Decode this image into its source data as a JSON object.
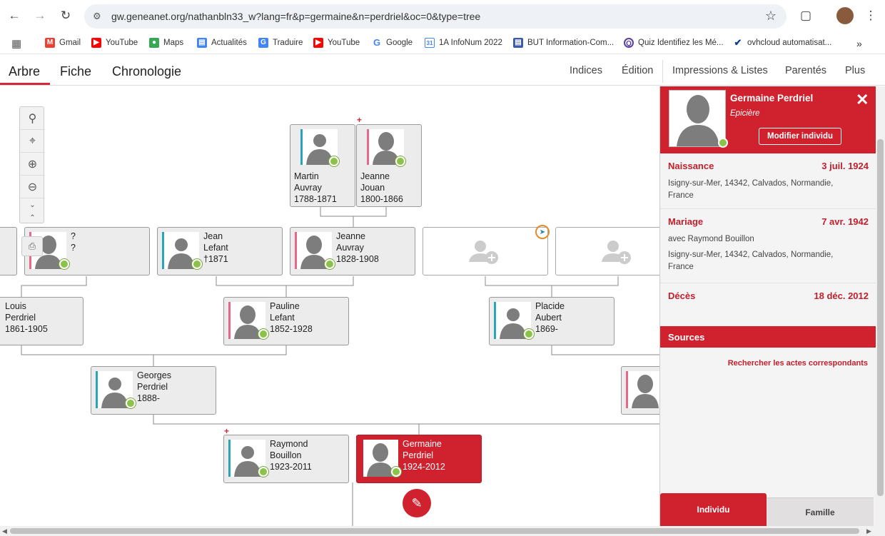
{
  "browser": {
    "url": "gw.geneanet.org/nathanbln33_w?lang=fr&p=germaine&n=perdriel&oc=0&type=tree",
    "bookmarks": [
      {
        "label": "Gmail",
        "color": "#ea4335"
      },
      {
        "label": "YouTube",
        "color": "#ff0000"
      },
      {
        "label": "Maps",
        "color": "#34a853"
      },
      {
        "label": "Actualités",
        "color": "#4285f4"
      },
      {
        "label": "Traduire",
        "color": "#4285f4"
      },
      {
        "label": "YouTube",
        "color": "#ff0000"
      },
      {
        "label": "Google",
        "color": "#4285f4"
      },
      {
        "label": "1A InfoNum 2022",
        "color": "#4285f4"
      },
      {
        "label": "BUT Information-Com...",
        "color": "#3b5bab"
      },
      {
        "label": "Quiz Identifiez les Mé...",
        "color": "#5b3ea8"
      },
      {
        "label": "ovhcloud automatisat...",
        "color": "#123f8c"
      }
    ],
    "more": "»"
  },
  "nav": {
    "tabs": [
      "Arbre",
      "Fiche",
      "Chronologie"
    ],
    "right": [
      "Indices",
      "Édition",
      "Impressions & Listes",
      "Parentés",
      "Plus"
    ]
  },
  "tree": {
    "people": {
      "martin": {
        "first": "Martin",
        "last": "Auvray",
        "dates": "1788-1871"
      },
      "jeanne_jouan": {
        "first": "Jeanne",
        "last": "Jouan",
        "dates": "1800-1866"
      },
      "unknown": {
        "first": "?",
        "last": "?"
      },
      "jean": {
        "first": "Jean",
        "last": "Lefant",
        "dates": "†1871"
      },
      "jeanne_auvray": {
        "first": "Jeanne",
        "last": "Auvray",
        "dates": "1828-1908"
      },
      "louis": {
        "first": "Louis",
        "last": "Perdriel",
        "dates": "1861-1905"
      },
      "pauline": {
        "first": "Pauline",
        "last": "Lefant",
        "dates": "1852-1928"
      },
      "placide": {
        "first": "Placide",
        "last": "Aubert",
        "dates": "1869-"
      },
      "georges": {
        "first": "Georges",
        "last": "Perdriel",
        "dates": "1888-"
      },
      "raymond": {
        "first": "Raymond",
        "last": "Bouillon",
        "dates": "1923-2011"
      },
      "germaine": {
        "first": "Germaine",
        "last": "Perdriel",
        "dates": "1924-2012"
      }
    },
    "colors": {
      "male": "#2aa4b8",
      "female": "#e56a8a",
      "selected": "#d0212e"
    }
  },
  "panel": {
    "name": "Germaine Perdriel",
    "occupation": "Epicière",
    "edit_button": "Modifier individu",
    "birth": {
      "label": "Naissance",
      "date": "3 juil. 1924",
      "place": "Isigny-sur-Mer, 14342, Calvados, Normandie, France"
    },
    "marriage": {
      "label": "Mariage",
      "date": "7 avr. 1942",
      "spouse": "avec Raymond Bouillon",
      "place": "Isigny-sur-Mer, 14342, Calvados, Normandie, France"
    },
    "death": {
      "label": "Décès",
      "date": "18 déc. 2012"
    },
    "sources": {
      "label": "Sources",
      "link": "Rechercher les actes correspondants"
    },
    "tabs": {
      "individu": "Individu",
      "famille": "Famille"
    }
  }
}
